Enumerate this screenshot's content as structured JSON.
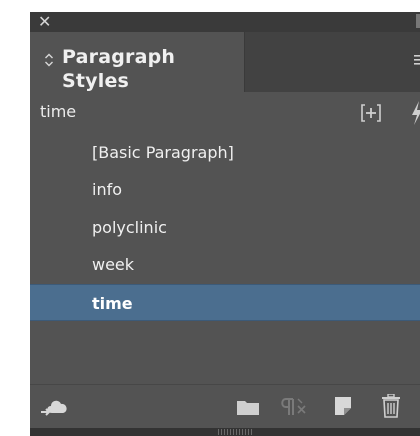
{
  "panel": {
    "title": "Paragraph Styles",
    "current_style": "time",
    "styles": [
      {
        "label": "[Basic Paragraph]",
        "selected": false
      },
      {
        "label": "info",
        "selected": false
      },
      {
        "label": "polyclinic",
        "selected": false
      },
      {
        "label": "week",
        "selected": false
      },
      {
        "label": "time",
        "selected": true
      }
    ],
    "icons": {
      "close": "close-icon",
      "tab_toggle": "expand-collapse-icon",
      "panel_menu": "panel-menu-icon",
      "new_group_from_selection": "plus-bracket-icon",
      "quick_apply": "lightning-icon",
      "cc_library": "cloud-upload-icon",
      "new_group": "folder-icon",
      "clear_overrides": "pilcrow-clear-icon",
      "new_style": "new-page-icon",
      "delete_style": "trash-icon"
    },
    "colors": {
      "panel_bg": "#535353",
      "selected_bg": "#4b6e8f",
      "text": "#f0f0f0"
    }
  },
  "glyphs": {
    "close": "✕"
  }
}
